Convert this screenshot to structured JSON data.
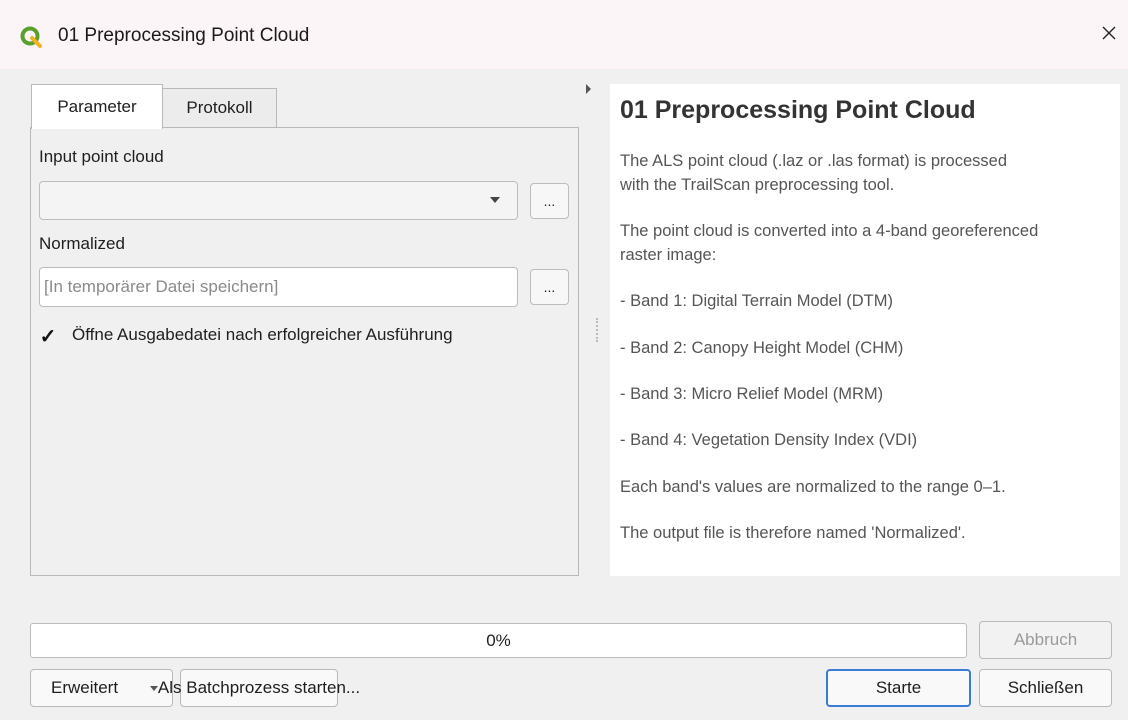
{
  "window": {
    "title": "01 Preprocessing Point Cloud",
    "close_glyph": "✕"
  },
  "tabs": [
    {
      "label": "Parameter",
      "active": true
    },
    {
      "label": "Protokoll",
      "active": false
    }
  ],
  "params": {
    "input_label": "Input point cloud",
    "input_value": "",
    "input_browse_label": "...",
    "output_label": "Normalized",
    "output_placeholder": "[In temporärer Datei speichern]",
    "output_browse_label": "...",
    "open_after_run": {
      "checked": true,
      "label": "Öffne Ausgabedatei nach erfolgreicher Ausführung"
    }
  },
  "help": {
    "title": "01 Preprocessing Point Cloud",
    "lines": [
      "The ALS point cloud (.laz or .las format) is processed",
      "with the TrailScan preprocessing tool.",
      "The point cloud is converted into a 4-band georeferenced",
      "raster image:",
      "- Band 1: Digital Terrain Model (DTM)",
      "- Band 2: Canopy Height Model (CHM)",
      "- Band 3: Micro Relief Model (MRM)",
      "- Band 4: Vegetation Density Index (VDI)",
      "Each band's values are normalized to the range 0–1.",
      "The output file is therefore named 'Normalized'."
    ]
  },
  "progress": {
    "value_percent": 0,
    "text": "0%"
  },
  "buttons": {
    "cancel": "Abbruch",
    "advanced": "Erweitert",
    "batch": "Als Batchprozess starten...",
    "run": "Starte",
    "close": "Schließen"
  },
  "colors": {
    "accent": "#3a7bd5",
    "logo_green": "#5aa02c",
    "logo_yellow": "#f0b323"
  },
  "icons": {
    "app": "qgis-logo-icon",
    "close": "close-icon",
    "dropdown": "chevron-down-icon",
    "collapse": "collapse-arrow-icon"
  }
}
